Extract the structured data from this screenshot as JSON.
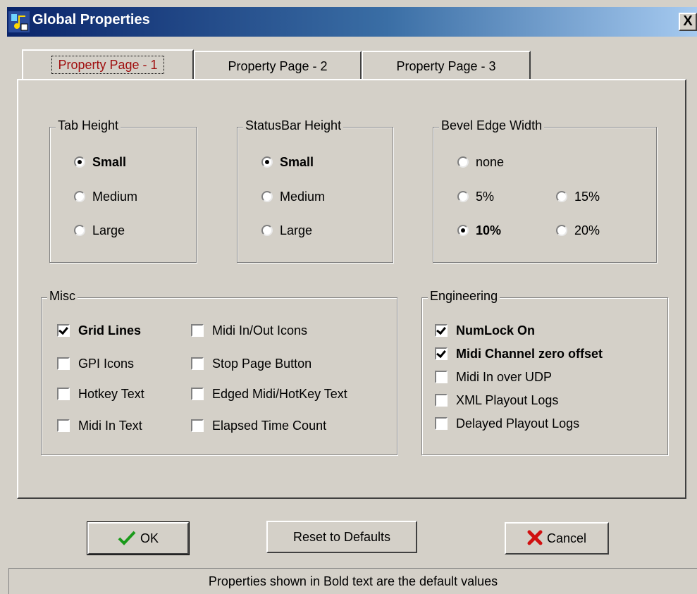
{
  "window": {
    "title": "Global Properties",
    "close_symbol": "X"
  },
  "tabs": [
    {
      "label": "Property Page - 1",
      "active": true
    },
    {
      "label": "Property Page - 2",
      "active": false
    },
    {
      "label": "Property Page - 3",
      "active": false
    }
  ],
  "tab_height": {
    "title": "Tab Height",
    "options": [
      {
        "label": "Small",
        "selected": true,
        "bold": true
      },
      {
        "label": "Medium",
        "selected": false,
        "bold": false
      },
      {
        "label": "Large",
        "selected": false,
        "bold": false
      }
    ]
  },
  "statusbar_height": {
    "title": "StatusBar Height",
    "options": [
      {
        "label": "Small",
        "selected": true,
        "bold": true
      },
      {
        "label": "Medium",
        "selected": false,
        "bold": false
      },
      {
        "label": "Large",
        "selected": false,
        "bold": false
      }
    ]
  },
  "bevel_edge_width": {
    "title": "Bevel Edge Width",
    "options": [
      {
        "label": "none",
        "selected": false,
        "bold": false
      },
      {
        "label": "5%",
        "selected": false,
        "bold": false
      },
      {
        "label": "15%",
        "selected": false,
        "bold": false
      },
      {
        "label": "10%",
        "selected": true,
        "bold": true
      },
      {
        "label": "20%",
        "selected": false,
        "bold": false
      }
    ]
  },
  "misc": {
    "title": "Misc",
    "options": [
      {
        "label": "Grid Lines",
        "checked": true,
        "bold": true
      },
      {
        "label": "GPI Icons",
        "checked": false,
        "bold": false
      },
      {
        "label": "Hotkey Text",
        "checked": false,
        "bold": false
      },
      {
        "label": "Midi In Text",
        "checked": false,
        "bold": false
      },
      {
        "label": "Midi In/Out Icons",
        "checked": false,
        "bold": false
      },
      {
        "label": "Stop Page Button",
        "checked": false,
        "bold": false
      },
      {
        "label": "Edged Midi/HotKey Text",
        "checked": false,
        "bold": false
      },
      {
        "label": "Elapsed Time Count",
        "checked": false,
        "bold": false
      }
    ]
  },
  "engineering": {
    "title": "Engineering",
    "options": [
      {
        "label": "NumLock On",
        "checked": true,
        "bold": true
      },
      {
        "label": "Midi Channel zero offset",
        "checked": true,
        "bold": true
      },
      {
        "label": "Midi In over UDP",
        "checked": false,
        "bold": false
      },
      {
        "label": "XML Playout Logs",
        "checked": false,
        "bold": false
      },
      {
        "label": "Delayed Playout Logs",
        "checked": false,
        "bold": false
      }
    ]
  },
  "buttons": {
    "ok": "OK",
    "reset": "Reset to Defaults",
    "cancel": "Cancel"
  },
  "icons": {
    "ok": "checkmark-icon",
    "cancel": "red-x-icon",
    "app": "app-icon"
  },
  "status": {
    "text": "Properties shown in Bold text are the default values"
  }
}
